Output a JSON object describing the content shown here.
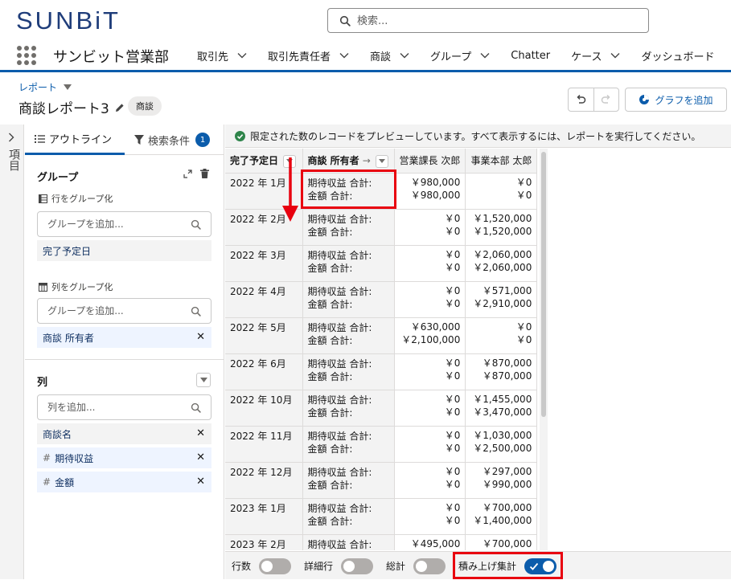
{
  "header": {
    "logo": "SUNBiT",
    "search_placeholder": "検索...",
    "app_name": "サンビット営業部",
    "nav": [
      {
        "label": "取引先"
      },
      {
        "label": "取引先責任者"
      },
      {
        "label": "商談"
      },
      {
        "label": "グループ"
      },
      {
        "label": "Chatter"
      },
      {
        "label": "ケース"
      },
      {
        "label": "ダッシュボード"
      }
    ]
  },
  "record": {
    "type_label": "レポート",
    "title": "商談レポート3",
    "badge": "商談",
    "add_chart_label": "グラフを追加"
  },
  "rail": {
    "label": "項目"
  },
  "panel": {
    "tab_outline": "アウトライン",
    "tab_filters": "検索条件",
    "filter_count": "1",
    "groups_title": "グループ",
    "group_rows_label": "行をグループ化",
    "group_add_placeholder": "グループを追加...",
    "row_group_item": "完了予定日",
    "group_cols_label": "列をグループ化",
    "col_group_item": "商談 所有者",
    "columns_title": "列",
    "column_add_placeholder": "列を追加...",
    "columns": [
      {
        "label": "商談名",
        "numeric": false
      },
      {
        "label": "期待収益",
        "numeric": true
      },
      {
        "label": "金額",
        "numeric": true
      }
    ]
  },
  "preview": {
    "message": "限定された数のレコードをプレビューしています。すべて表示するには、レポートを実行してください。"
  },
  "table": {
    "headers": {
      "date": "完了予定日",
      "owner": "商談 所有者",
      "arrow": "→",
      "col1": "営業課長 次郎",
      "col2": "事業本部 太郎"
    },
    "label1": "期待収益 合計:",
    "label2": "金額 合計:",
    "rows": [
      {
        "date": "2022 年 1月",
        "c1a": "￥980,000",
        "c1b": "￥980,000",
        "c2a": "￥0",
        "c2b": "￥0"
      },
      {
        "date": "2022 年 2月",
        "c1a": "￥0",
        "c1b": "￥0",
        "c2a": "￥1,520,000",
        "c2b": "￥1,520,000"
      },
      {
        "date": "2022 年 3月",
        "c1a": "￥0",
        "c1b": "￥0",
        "c2a": "￥2,060,000",
        "c2b": "￥2,060,000"
      },
      {
        "date": "2022 年 4月",
        "c1a": "￥0",
        "c1b": "￥0",
        "c2a": "￥571,000",
        "c2b": "￥2,910,000"
      },
      {
        "date": "2022 年 5月",
        "c1a": "￥630,000",
        "c1b": "￥2,100,000",
        "c2a": "￥0",
        "c2b": "￥0"
      },
      {
        "date": "2022 年 6月",
        "c1a": "￥0",
        "c1b": "￥0",
        "c2a": "￥870,000",
        "c2b": "￥870,000"
      },
      {
        "date": "2022 年 10月",
        "c1a": "￥0",
        "c1b": "￥0",
        "c2a": "￥1,455,000",
        "c2b": "￥3,470,000"
      },
      {
        "date": "2022 年 11月",
        "c1a": "￥0",
        "c1b": "￥0",
        "c2a": "￥1,030,000",
        "c2b": "￥2,500,000"
      },
      {
        "date": "2022 年 12月",
        "c1a": "￥0",
        "c1b": "￥0",
        "c2a": "￥297,000",
        "c2b": "￥990,000"
      },
      {
        "date": "2023 年 1月",
        "c1a": "￥0",
        "c1b": "￥0",
        "c2a": "￥700,000",
        "c2b": "￥1,400,000"
      },
      {
        "date": "2023 年 2月",
        "c1a": "￥495,000",
        "c1b": "",
        "c2a": "￥700,000",
        "c2b": ""
      }
    ]
  },
  "footer": {
    "row_count": "行数",
    "detail_rows": "詳細行",
    "grand_total": "総計",
    "stacked_summary": "積み上げ集計"
  },
  "toggles": {
    "row_count": false,
    "detail_rows": false,
    "grand_total": false,
    "stacked_summary": true
  },
  "colors": {
    "brand": "#1f3d7a",
    "accent": "#0b5cab",
    "annotation": "#e8000f",
    "success": "#2e844a"
  }
}
